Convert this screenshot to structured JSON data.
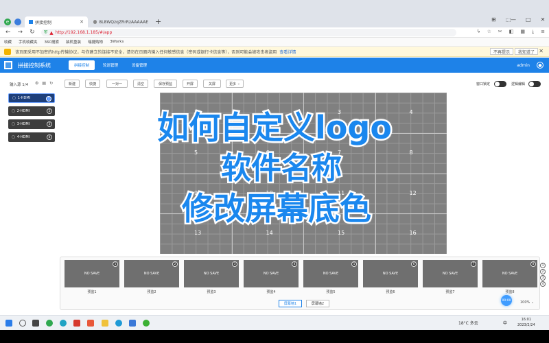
{
  "browser": {
    "tabs": [
      {
        "label": "拼接控制",
        "active": true
      },
      {
        "label": "8L8WQzqZRrRzAAAAAE",
        "active": false
      }
    ],
    "url": "http://192.168.1.185/#/app",
    "bookmarks": [
      "收藏",
      "手机收藏夹",
      "360搜索",
      "装机重装",
      "瑞捷购物",
      "3Works"
    ],
    "warning_text": "该页面采用不加密的http传输协议，与你建立的连接不安全，请勿在页面内输入任何敏感信息（密码或银行卡信息等），否则可能会被攻击者盗用",
    "warning_link": "查看详情",
    "warning_buttons": [
      "不再提示",
      "我知道了"
    ],
    "win_controls": [
      "—",
      "□",
      "✕"
    ]
  },
  "app": {
    "title": "拼接控制系统",
    "nav": [
      {
        "label": "拼接控制",
        "active": true
      },
      {
        "label": "轮巡管理",
        "active": false
      },
      {
        "label": "设备管理",
        "active": false
      }
    ],
    "user": "admin"
  },
  "toolbar": {
    "input_source_label": "输入源 1/4",
    "buttons": [
      "新建",
      "快捷",
      "一对一",
      "清空",
      "保存预监",
      "开屏",
      "关屏",
      "更多"
    ],
    "toggles": [
      {
        "label": "窗口锁定",
        "on": false
      },
      {
        "label": "逻辑编辑",
        "on": false
      }
    ]
  },
  "inputs": [
    {
      "label": "1-HDMI",
      "num": "1",
      "active": true
    },
    {
      "label": "2-HDMI",
      "num": "2",
      "active": false
    },
    {
      "label": "3-HDMI",
      "num": "3",
      "active": false
    },
    {
      "label": "4-HDMI",
      "num": "4",
      "active": false
    }
  ],
  "wall": {
    "screen_numbers": [
      "1",
      "2",
      "3",
      "4",
      "5",
      "6",
      "7",
      "8",
      "9",
      "10",
      "11",
      "12",
      "13",
      "14",
      "15",
      "16"
    ]
  },
  "overlay": {
    "line1": "如何自定义logo",
    "line2": "软件名称",
    "line3": "修改屏幕底色"
  },
  "presets": {
    "items": [
      {
        "thumb": "NO SAVE",
        "num": "1",
        "label": "预监1"
      },
      {
        "thumb": "NO SAVE",
        "num": "2",
        "label": "预监2"
      },
      {
        "thumb": "NO SAVE",
        "num": "3",
        "label": "预监3"
      },
      {
        "thumb": "NO SAVE",
        "num": "4",
        "label": "预监4"
      },
      {
        "thumb": "NO SAVE",
        "num": "5",
        "label": "预监5"
      },
      {
        "thumb": "NO SAVE",
        "num": "6",
        "label": "预监6"
      },
      {
        "thumb": "NO SAVE",
        "num": "7",
        "label": "预监7"
      },
      {
        "thumb": "NO SAVE",
        "num": "8",
        "label": "预监8"
      }
    ],
    "pages": [
      "1",
      "2",
      "3",
      "4"
    ],
    "scene_buttons": [
      {
        "label": "屏幕墙1",
        "active": true
      },
      {
        "label": "屏幕墙2",
        "active": false
      }
    ],
    "zoom_badge": "00:00",
    "zoom_level": "100%"
  },
  "taskbar": {
    "weather": "18°C 多云",
    "ime": "中",
    "time": "16:01",
    "date": "2023/2/24"
  },
  "colors": {
    "accent": "#1e82e8",
    "overlay_text": "#1a87ee",
    "wall": "#808080"
  }
}
